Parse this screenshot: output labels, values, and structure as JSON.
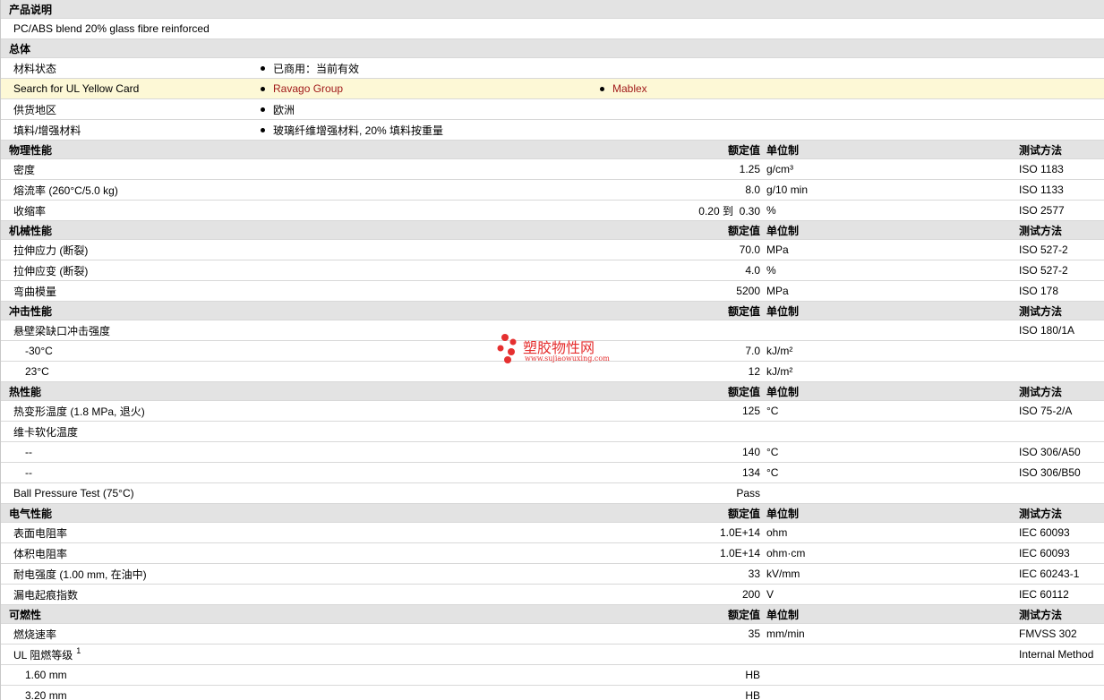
{
  "sections": {
    "product_desc": {
      "title": "产品说明",
      "text": "PC/ABS blend 20% glass fibre reinforced"
    },
    "general": {
      "title": "总体",
      "rows": [
        {
          "label": "材料状态",
          "bullets": [
            "已商用：当前有效"
          ]
        },
        {
          "label": "Search for UL Yellow Card",
          "bullets": [
            "Ravago Group",
            "Mablex"
          ]
        },
        {
          "label": "供货地区",
          "bullets": [
            "欧洲"
          ]
        },
        {
          "label": "填料/增强材料",
          "bullets": [
            "玻璃纤维增强材料, 20% 填料按重量"
          ]
        }
      ]
    },
    "physical": {
      "title": "物理性能",
      "h_value": "额定值",
      "h_unit": "单位制",
      "h_test": "测试方法",
      "rows": [
        {
          "label": "密度",
          "value": "1.25",
          "unit": "g/cm³",
          "test": "ISO 1183"
        },
        {
          "label": "熔流率 (260°C/5.0 kg)",
          "value": "8.0",
          "unit": "g/10 min",
          "test": "ISO 1133"
        },
        {
          "label": "收缩率",
          "value": "0.20 到  0.30",
          "unit": "%",
          "test": "ISO 2577"
        }
      ]
    },
    "mechanical": {
      "title": "机械性能",
      "h_value": "额定值",
      "h_unit": "单位制",
      "h_test": "测试方法",
      "rows": [
        {
          "label": "拉伸应力 (断裂)",
          "value": "70.0",
          "unit": "MPa",
          "test": "ISO 527-2"
        },
        {
          "label": "拉伸应变 (断裂)",
          "value": "4.0",
          "unit": "%",
          "test": "ISO 527-2"
        },
        {
          "label": "弯曲模量",
          "value": "5200",
          "unit": "MPa",
          "test": "ISO 178"
        }
      ]
    },
    "impact": {
      "title": "冲击性能",
      "h_value": "额定值",
      "h_unit": "单位制",
      "h_test": "测试方法",
      "rows": [
        {
          "label": "悬壁梁缺口冲击强度",
          "value": "",
          "unit": "",
          "test": "ISO 180/1A"
        },
        {
          "label": "-30°C",
          "value": "7.0",
          "unit": "kJ/m²",
          "test": ""
        },
        {
          "label": "23°C",
          "value": "12",
          "unit": "kJ/m²",
          "test": ""
        }
      ]
    },
    "thermal": {
      "title": "热性能",
      "h_value": "额定值",
      "h_unit": "单位制",
      "h_test": "测试方法",
      "rows": [
        {
          "label": "热变形温度 (1.8 MPa, 退火)",
          "value": "125",
          "unit": "°C",
          "test": "ISO 75-2/A"
        },
        {
          "label": "维卡软化温度",
          "value": "",
          "unit": "",
          "test": ""
        },
        {
          "label": "--",
          "value": "140",
          "unit": "°C",
          "test": "ISO 306/A50"
        },
        {
          "label": "--",
          "value": "134",
          "unit": "°C",
          "test": "ISO 306/B50"
        },
        {
          "label": "Ball Pressure Test (75°C)",
          "value": "Pass",
          "unit": "",
          "test": ""
        }
      ]
    },
    "electrical": {
      "title": "电气性能",
      "h_value": "额定值",
      "h_unit": "单位制",
      "h_test": "测试方法",
      "rows": [
        {
          "label": "表面电阻率",
          "value": "1.0E+14",
          "unit": "ohm",
          "test": "IEC 60093"
        },
        {
          "label": "体积电阻率",
          "value": "1.0E+14",
          "unit": "ohm·cm",
          "test": "IEC 60093"
        },
        {
          "label": "耐电强度 (1.00 mm, 在油中)",
          "value": "33",
          "unit": "kV/mm",
          "test": "IEC 60243-1"
        },
        {
          "label": "漏电起痕指数",
          "value": "200",
          "unit": "V",
          "test": "IEC 60112"
        }
      ]
    },
    "flammability": {
      "title": "可燃性",
      "h_value": "额定值",
      "h_unit": "单位制",
      "h_test": "测试方法",
      "rows": [
        {
          "label": "燃烧速率",
          "value": "35",
          "unit": "mm/min",
          "test": "FMVSS 302"
        },
        {
          "label": "UL 阻燃等级",
          "sup": "1",
          "value": "",
          "unit": "",
          "test": "Internal Method"
        },
        {
          "label": "1.60 mm",
          "value": "HB",
          "unit": "",
          "test": ""
        },
        {
          "label": "3.20 mm",
          "value": "HB",
          "unit": "",
          "test": ""
        }
      ]
    }
  },
  "watermark": {
    "name": "塑胶物性网",
    "url": "www.sujiaowuxing.com",
    "color": "#e53030"
  },
  "colors": {
    "header_bg": "#e3e3e3",
    "highlight_bg": "#fdf8d6",
    "link": "#a11a1a"
  }
}
